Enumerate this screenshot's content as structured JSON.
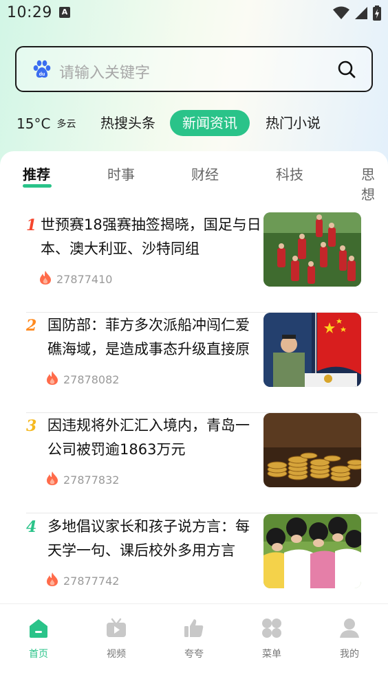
{
  "status_bar": {
    "time": "10:29",
    "notification_badge": "A"
  },
  "search": {
    "placeholder": "请输入关键字",
    "logo_icon": "baidu-paw-icon",
    "button_icon": "search-icon"
  },
  "weather": {
    "temperature": "15°C",
    "condition": "多云"
  },
  "top_tabs": [
    {
      "label": "热搜头条",
      "active": false
    },
    {
      "label": "新闻资讯",
      "active": true
    },
    {
      "label": "热门小说",
      "active": false
    }
  ],
  "category_tabs": [
    {
      "label": "推荐",
      "active": true
    },
    {
      "label": "时事",
      "active": false
    },
    {
      "label": "财经",
      "active": false
    },
    {
      "label": "科技",
      "active": false
    },
    {
      "label": "思想",
      "active": false
    }
  ],
  "news": [
    {
      "rank": "1",
      "rank_color": "#f5462d",
      "title": "世预赛18强赛抽签揭晓，国足与日本、澳大利亚、沙特同组",
      "heat": "27877410"
    },
    {
      "rank": "2",
      "rank_color": "#ff8a1f",
      "title": "国防部：菲方多次派船冲闯仁爱礁海域，是造成事态升级直接原因",
      "heat": "27878082"
    },
    {
      "rank": "3",
      "rank_color": "#f5b81f",
      "title": "因违规将外汇汇入境内，青岛一公司被罚逾1863万元",
      "heat": "27877832"
    },
    {
      "rank": "4",
      "rank_color": "#2ac389",
      "title": "多地倡议家长和孩子说方言：每天学一句、课后校外多用方言",
      "heat": "27877742"
    }
  ],
  "bottom_nav": [
    {
      "label": "首页",
      "icon": "home-icon",
      "active": true
    },
    {
      "label": "视频",
      "icon": "tv-icon",
      "active": false
    },
    {
      "label": "夸夸",
      "icon": "thumbs-up-icon",
      "active": false
    },
    {
      "label": "菜单",
      "icon": "grid-menu-icon",
      "active": false
    },
    {
      "label": "我的",
      "icon": "user-icon",
      "active": false
    }
  ],
  "colors": {
    "accent": "#2ac389",
    "fire": "#ff6b4a"
  }
}
